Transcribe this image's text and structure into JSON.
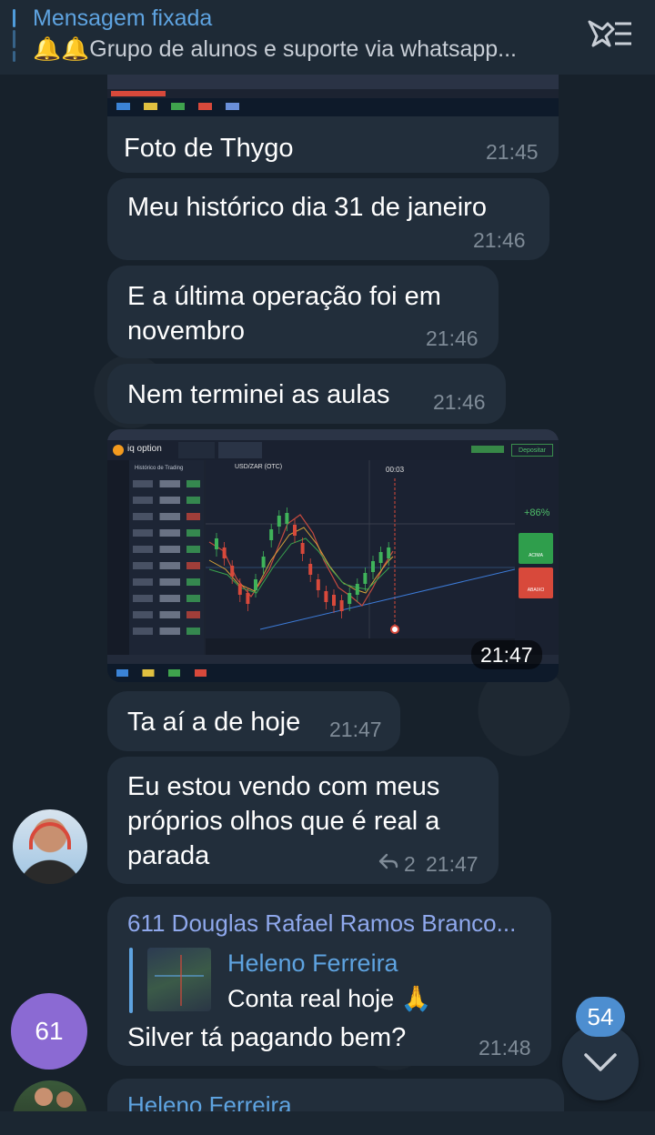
{
  "pinned": {
    "title": "Mensagem fixada",
    "text": "🔔🔔Grupo de alunos e suporte via whatsapp..."
  },
  "messages": [
    {
      "text": "Foto de Thygo",
      "time": "21:45"
    },
    {
      "text": "Meu histórico dia 31 de janeiro",
      "time": "21:46"
    },
    {
      "text": "E a última operação foi em novembro",
      "line1": "E a última operação foi em",
      "line2": "novembro",
      "time": "21:46"
    },
    {
      "text": "Nem terminei as aulas",
      "time": "21:46"
    },
    {
      "photo_time": "21:47"
    },
    {
      "text": "Ta aí a de hoje",
      "time": "21:47"
    },
    {
      "line1": "Eu estou vendo com meus",
      "line2": "próprios olhos que é real a",
      "line3": "parada",
      "replies": "2",
      "time": "21:47"
    },
    {
      "author": "611 Douglas Rafael Ramos Branco...",
      "quote_author": "Heleno Ferreira",
      "quote_text": "Conta real hoje 🙏",
      "text": "Silver tá pagando bem?",
      "time": "21:48"
    },
    {
      "author": "Heleno Ferreira"
    }
  ],
  "avatar_61": "61",
  "scroll_badge": "54",
  "trading_screenshot": {
    "brand": "iq option",
    "asset": "USD/ZAR (OTC)",
    "timer": "00:03",
    "payout": "+86%",
    "up_label": "ACIMA",
    "down_label": "ABAIXO",
    "deposit": "Depositar",
    "sidebar_title": "Histórico de Trading"
  },
  "colors": {
    "accent": "#5ea3e0",
    "bubble": "#222e3b",
    "background": "#17212b",
    "badge": "#4d8ed0",
    "avatar_61": "#8b6ad3",
    "buy": "#2f9e4c",
    "sell": "#d8493b"
  }
}
